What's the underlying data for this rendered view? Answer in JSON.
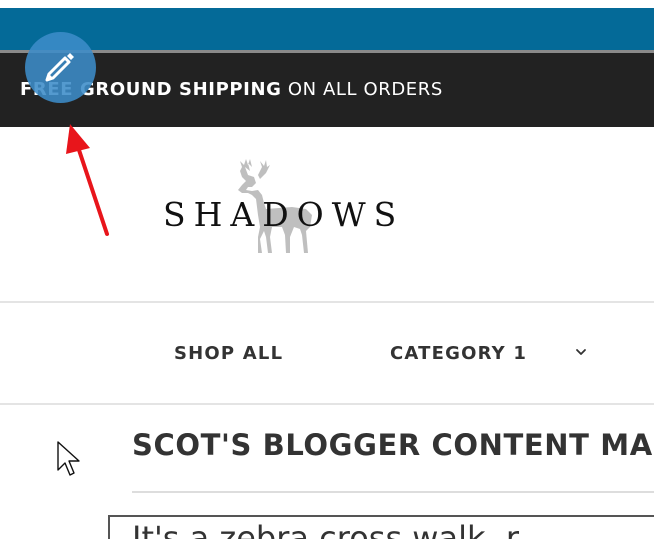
{
  "announcement": {
    "bold_text": "FREE GROUND SHIPPING",
    "rest_text": " ON ALL ORDERS"
  },
  "logo": {
    "text": "SHADOWS",
    "icon": "deer-icon"
  },
  "nav": {
    "items": [
      {
        "label": "SHOP ALL"
      },
      {
        "label": "CATEGORY 1",
        "icon": "chevron-down-icon"
      }
    ]
  },
  "content": {
    "title": "SCOT'S BLOGGER CONTENT MA",
    "body_text": "It's a zebra cross walk, r"
  },
  "overlay": {
    "edit_button_icon": "pencil-icon",
    "annotation": "red-arrow",
    "cursor": "mouse-pointer-icon"
  },
  "colors": {
    "top_bar": "#046a98",
    "announcement_bg": "#222222",
    "edit_button": "#3c8cc8",
    "arrow": "#e8151b"
  }
}
